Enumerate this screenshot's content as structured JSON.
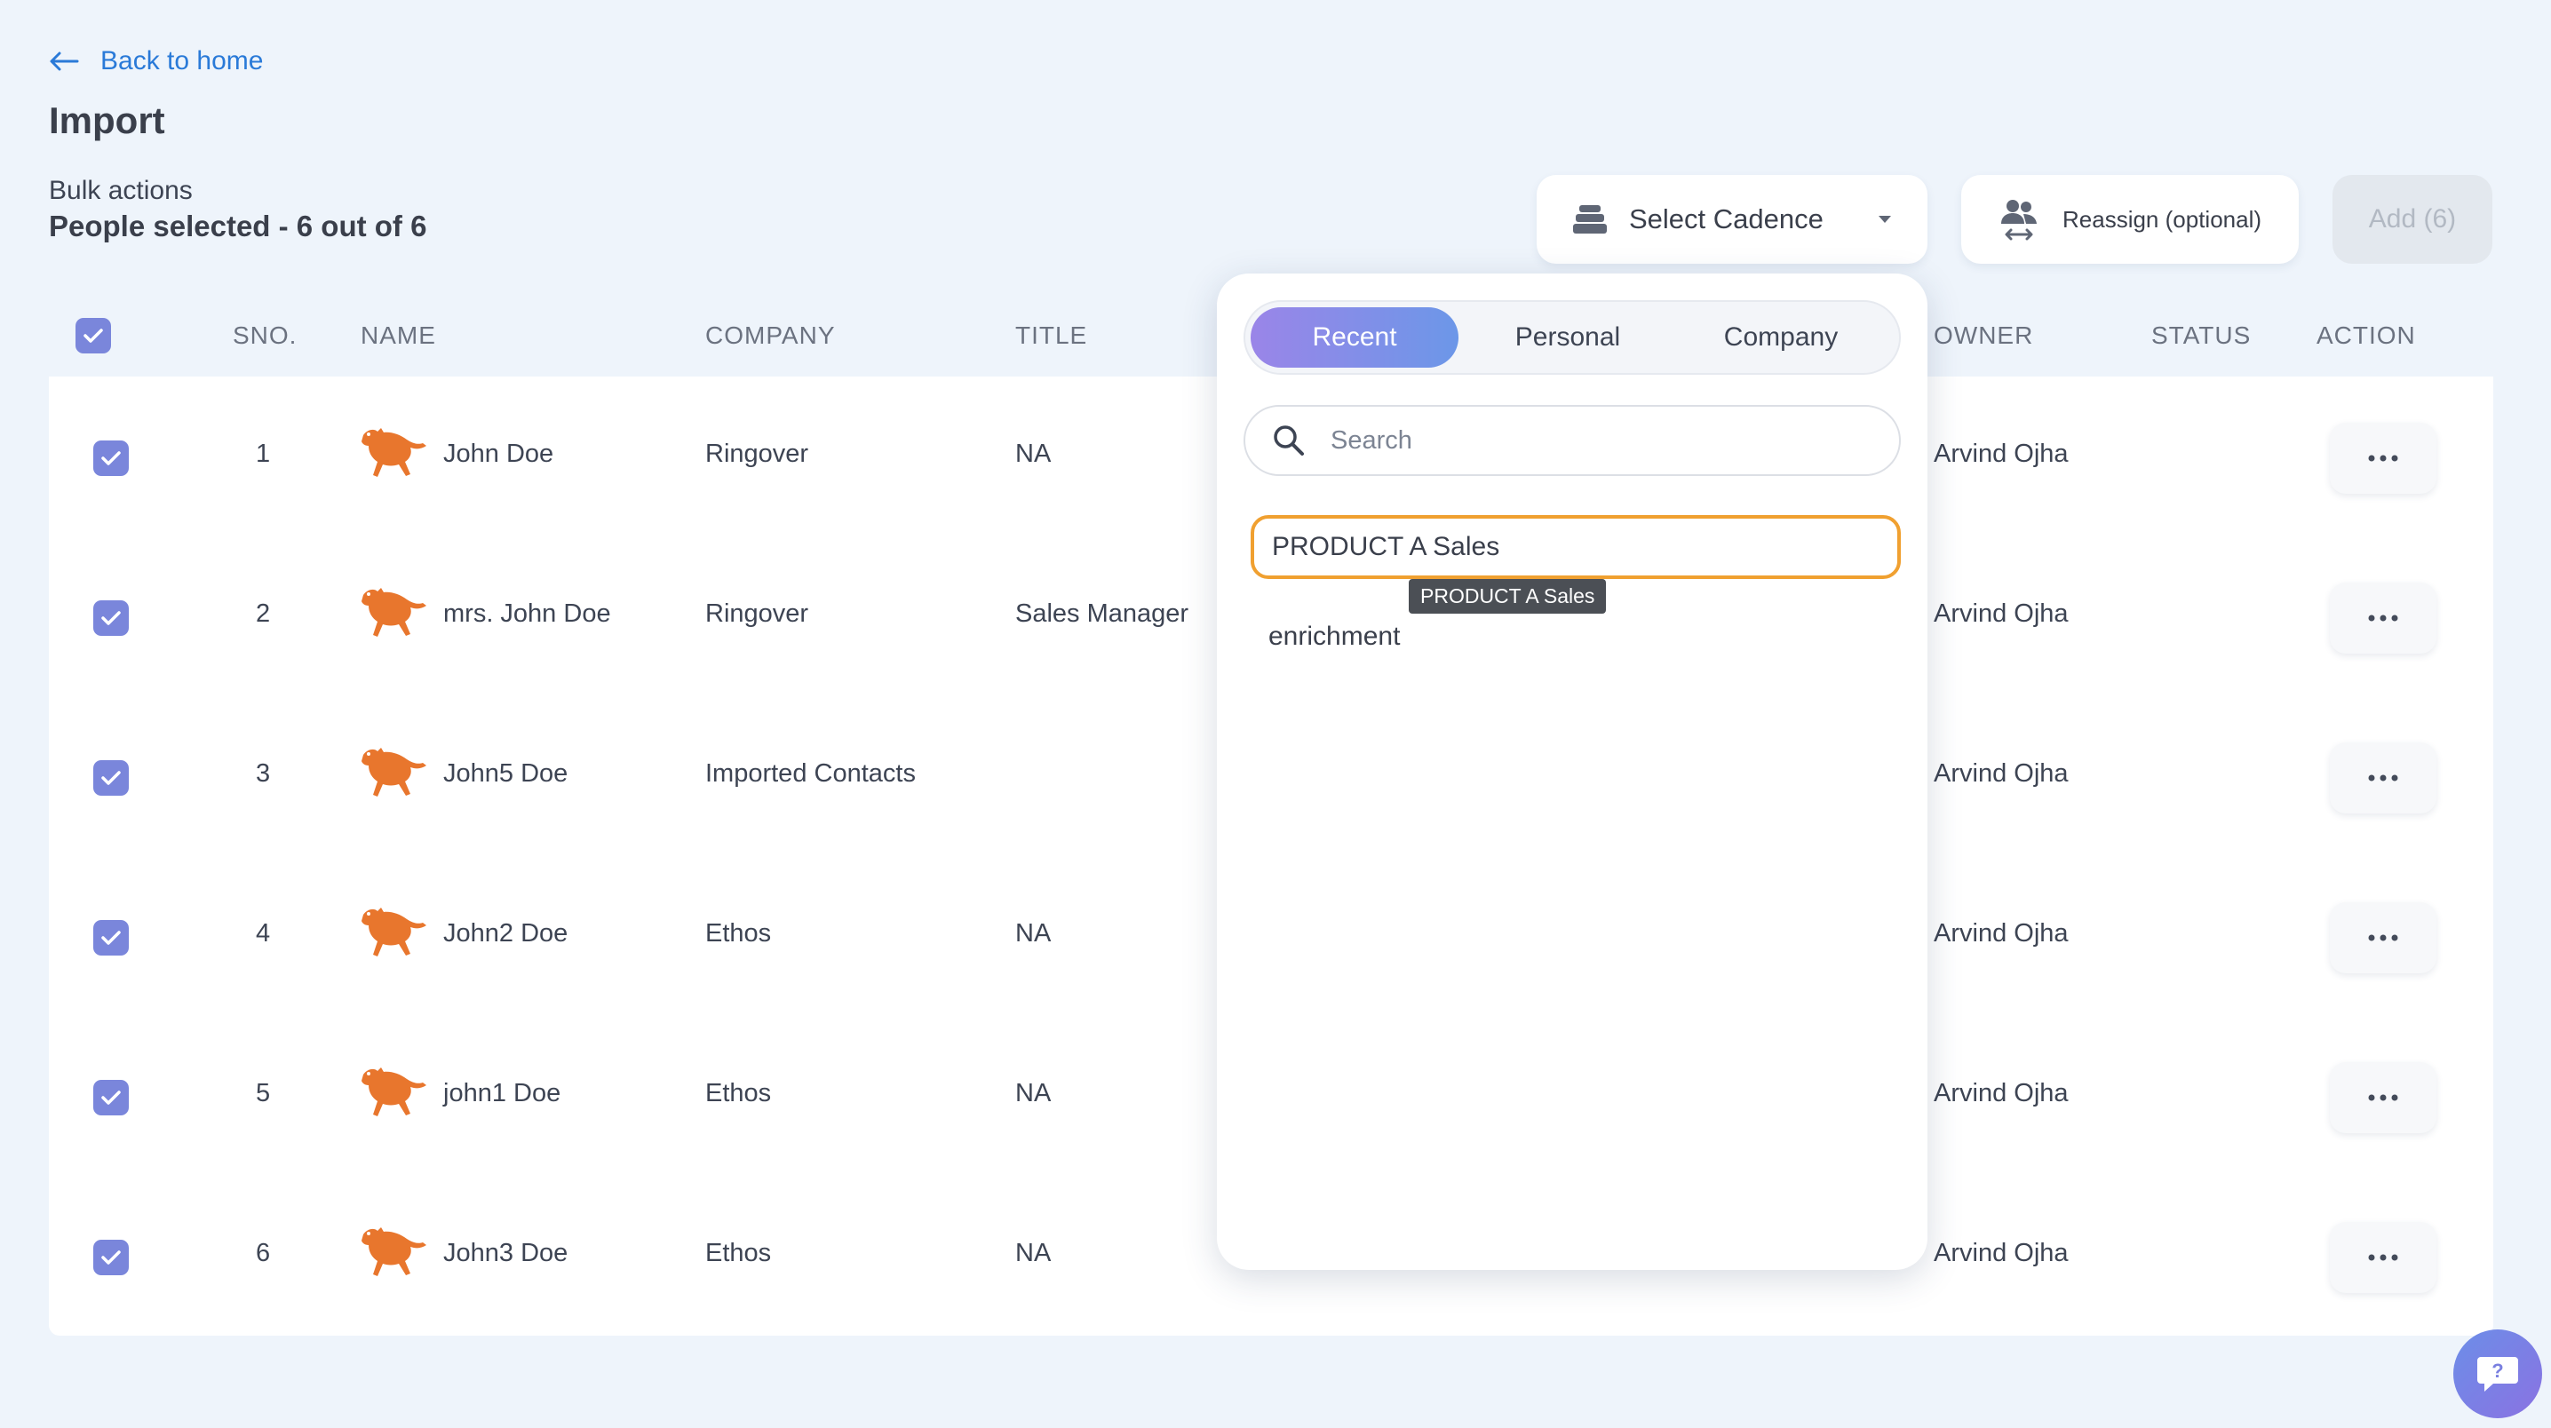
{
  "nav": {
    "back_label": "Back to home"
  },
  "page": {
    "title": "Import",
    "bulk_label": "Bulk actions",
    "people_selected": "People selected - 6 out of 6"
  },
  "toolbar": {
    "select_cadence": "Select Cadence",
    "reassign": "Reassign (optional)",
    "add": "Add (6)"
  },
  "table": {
    "headers": {
      "sno": "SNO.",
      "name": "NAME",
      "company": "COMPANY",
      "title": "TITLE",
      "owner": "OWNER",
      "status": "STATUS",
      "action": "ACTION"
    },
    "rows": [
      {
        "sno": "1",
        "name": "John Doe",
        "company": "Ringover",
        "title": "NA",
        "owner": "Arvind Ojha",
        "checked": true
      },
      {
        "sno": "2",
        "name": "mrs. John Doe",
        "company": "Ringover",
        "title": "Sales Manager",
        "owner": "Arvind Ojha",
        "checked": true
      },
      {
        "sno": "3",
        "name": "John5 Doe",
        "company": "Imported Contacts",
        "title": "",
        "owner": "Arvind Ojha",
        "checked": true
      },
      {
        "sno": "4",
        "name": "John2 Doe",
        "company": "Ethos",
        "title": "NA",
        "owner": "Arvind Ojha",
        "checked": true
      },
      {
        "sno": "5",
        "name": "john1 Doe",
        "company": "Ethos",
        "title": "NA",
        "owner": "Arvind Ojha",
        "checked": true
      },
      {
        "sno": "6",
        "name": "John3 Doe",
        "company": "Ethos",
        "title": "NA",
        "owner": "Arvind Ojha",
        "checked": true
      }
    ]
  },
  "dropdown": {
    "tabs": [
      {
        "label": "Recent",
        "active": true
      },
      {
        "label": "Personal",
        "active": false
      },
      {
        "label": "Company",
        "active": false
      }
    ],
    "search_placeholder": "Search",
    "options": [
      {
        "label": "PRODUCT A Sales",
        "highlighted": true
      },
      {
        "label": "enrichment",
        "highlighted": false
      }
    ],
    "tooltip": "PRODUCT A Sales"
  },
  "colors": {
    "accent": "#7a86db",
    "link": "#2a7ad8",
    "avatar": "#e8762d",
    "highlight": "#f0a030",
    "background": "#eef4fb"
  },
  "icons": {
    "back": "arrow-left-icon",
    "cadence": "stack-icon",
    "reassign": "people-swap-icon",
    "search": "search-icon",
    "more": "ellipsis-icon",
    "help": "chat-question-icon"
  }
}
